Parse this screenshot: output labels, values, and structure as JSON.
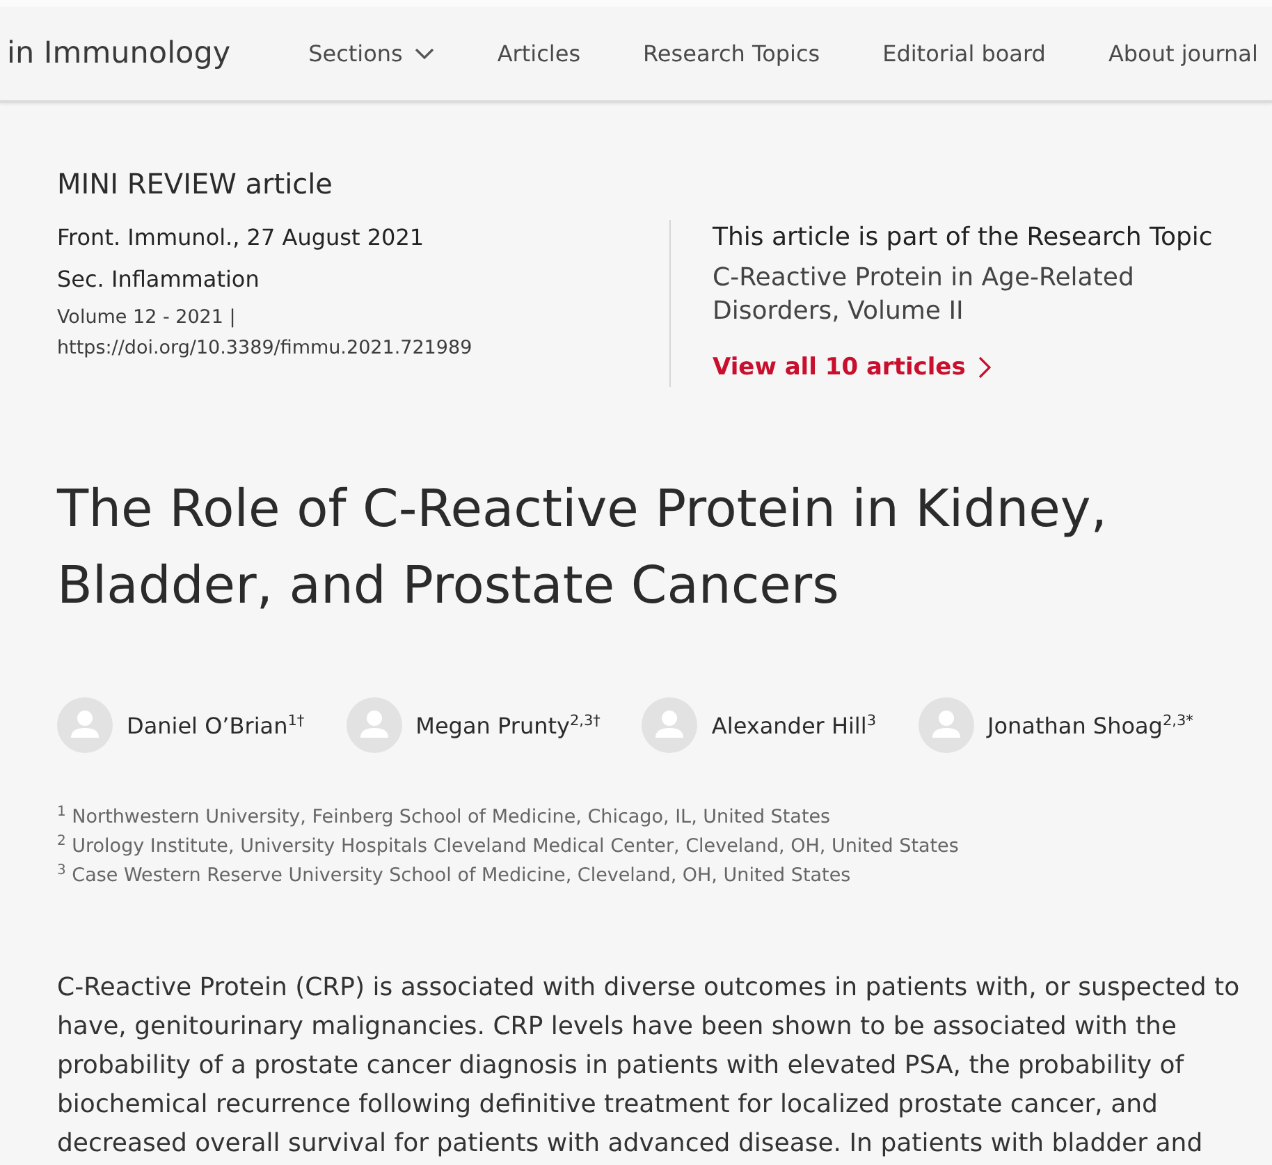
{
  "header": {
    "journal": "in Immunology",
    "nav": [
      {
        "label": "Sections",
        "has_menu": true
      },
      {
        "label": "Articles",
        "has_menu": false
      },
      {
        "label": "Research Topics",
        "has_menu": false
      },
      {
        "label": "Editorial board",
        "has_menu": false
      },
      {
        "label": "About journal",
        "has_menu": false
      }
    ]
  },
  "article": {
    "type": "MINI REVIEW article",
    "citation": "Front. Immunol., 27 August 2021",
    "section": "Sec. Inflammation",
    "volume": "Volume 12 - 2021 |",
    "doi": "https://doi.org/10.3389/fimmu.2021.721989"
  },
  "research_topic": {
    "heading": "This article is part of the Research Topic",
    "title": "C-Reactive Protein in Age-Related Disorders, Volume II",
    "link": "View all 10 articles"
  },
  "title": "The Role of C-Reactive Protein in Kidney, Bladder, and Prostate Cancers",
  "authors": [
    {
      "name": "Daniel O’Brian$^{1†}$"
    },
    {
      "name": "Megan Prunty$^{2,3†}$"
    },
    {
      "name": "Alexander Hill$^{3}$"
    },
    {
      "name": "Jonathan Shoag$^{2,3*}$"
    }
  ],
  "affiliations": [
    "$^{1}$ Northwestern University, Feinberg School of Medicine, Chicago, IL, United States",
    "$^{2}$ Urology Institute, University Hospitals Cleveland Medical Center, Cleveland, OH, United States",
    "$^{3}$ Case Western Reserve University School of Medicine, Cleveland, OH, United States"
  ],
  "abstract": "C-Reactive Protein (CRP) is associated with diverse outcomes in patients with, or suspected to have, genitourinary malignancies. CRP levels have been shown to be associated with the probability of a prostate cancer diagnosis in patients with elevated PSA, the probability of biochemical recurrence following definitive treatment for localized prostate cancer, and decreased overall survival for patients with advanced disease. In patients with bladder and"
}
